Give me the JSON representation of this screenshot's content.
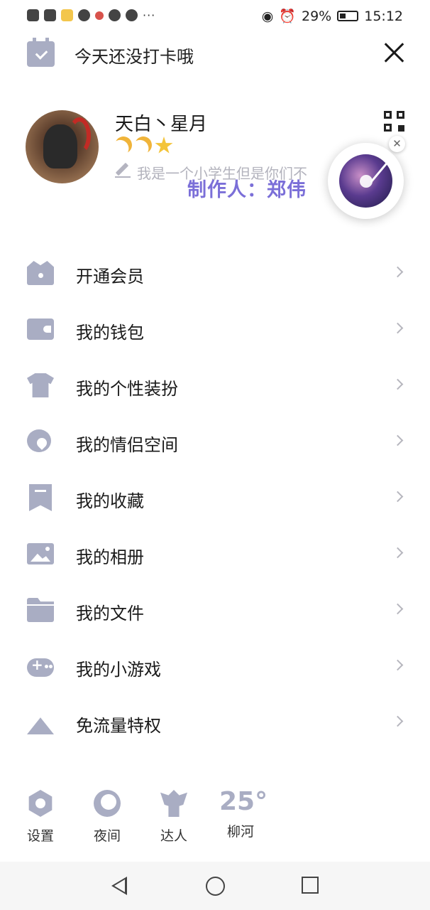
{
  "status_bar": {
    "battery": "29%",
    "time": "15:12",
    "more": "···"
  },
  "checkin": {
    "text": "今天还没打卡哦"
  },
  "profile": {
    "nickname": "天白丶星月",
    "signature": "我是一个小学生但是你们不",
    "watermark": "制作人：郑伟",
    "close_mark": "✕"
  },
  "menu": [
    {
      "label": "开通会员",
      "icon": "crown-icon"
    },
    {
      "label": "我的钱包",
      "icon": "wallet-icon"
    },
    {
      "label": "我的个性装扮",
      "icon": "shirt-icon"
    },
    {
      "label": "我的情侣空间",
      "icon": "hearts-icon"
    },
    {
      "label": "我的收藏",
      "icon": "bookmark-icon"
    },
    {
      "label": "我的相册",
      "icon": "photo-icon"
    },
    {
      "label": "我的文件",
      "icon": "folder-icon"
    },
    {
      "label": "我的小游戏",
      "icon": "gamepad-icon"
    },
    {
      "label": "免流量特权",
      "icon": "signal-tower-icon"
    }
  ],
  "tools": {
    "settings": "设置",
    "night": "夜间",
    "talent": "达人",
    "temperature": "25°",
    "city": "柳河"
  },
  "colors": {
    "icon_gray": "#a9adc3",
    "watermark": "#7b6fd8",
    "star": "#f3c43a"
  }
}
